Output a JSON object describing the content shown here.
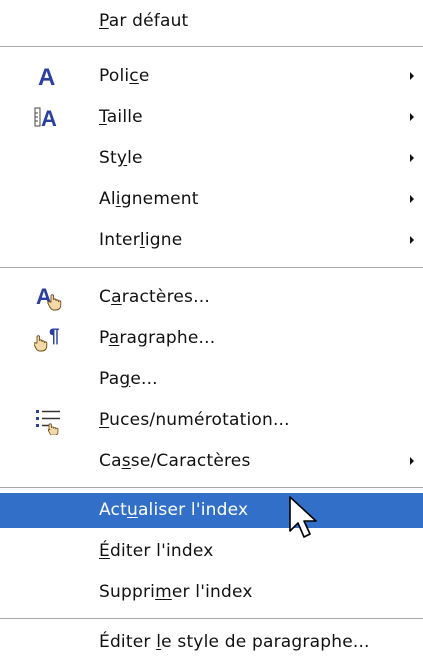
{
  "menu": {
    "items": [
      {
        "pre": "",
        "acc": "P",
        "post": "ar défaut",
        "submenu": false,
        "icon": ""
      },
      {
        "pre": "Poli",
        "acc": "c",
        "post": "e",
        "submenu": true,
        "icon": "font-icon"
      },
      {
        "pre": "",
        "acc": "T",
        "post": "aille",
        "submenu": true,
        "icon": "font-size-icon"
      },
      {
        "pre": "St",
        "acc": "y",
        "post": "le",
        "submenu": true,
        "icon": ""
      },
      {
        "pre": "Al",
        "acc": "i",
        "post": "gnement",
        "submenu": true,
        "icon": ""
      },
      {
        "pre": "Inter",
        "acc": "l",
        "post": "igne",
        "submenu": true,
        "icon": ""
      },
      {
        "pre": "C",
        "acc": "a",
        "post": "ractères...",
        "submenu": false,
        "icon": "characters-icon"
      },
      {
        "pre": "P",
        "acc": "a",
        "post": "ragraphe...",
        "submenu": false,
        "icon": "paragraph-icon"
      },
      {
        "pre": "Pa",
        "acc": "g",
        "post": "e...",
        "submenu": false,
        "icon": ""
      },
      {
        "pre": "",
        "acc": "P",
        "post": "uces/numérotation...",
        "submenu": false,
        "icon": "bullets-numbering-icon"
      },
      {
        "pre": "Ca",
        "acc": "s",
        "post": "se/Caractères",
        "submenu": true,
        "icon": ""
      },
      {
        "pre": "Act",
        "acc": "u",
        "post": "aliser l'index",
        "submenu": false,
        "icon": "",
        "highlighted": true
      },
      {
        "pre": "",
        "acc": "É",
        "post": "diter l'index",
        "submenu": false,
        "icon": ""
      },
      {
        "pre": "Suppri",
        "acc": "m",
        "post": "er l'index",
        "submenu": false,
        "icon": ""
      },
      {
        "pre": "Éditer ",
        "acc": "l",
        "post": "e style de paragraphe...",
        "submenu": false,
        "icon": ""
      }
    ]
  },
  "colors": {
    "highlight": "#326fc8",
    "icon_blue": "#2b3fa0",
    "separator": "#a9a9a9"
  }
}
